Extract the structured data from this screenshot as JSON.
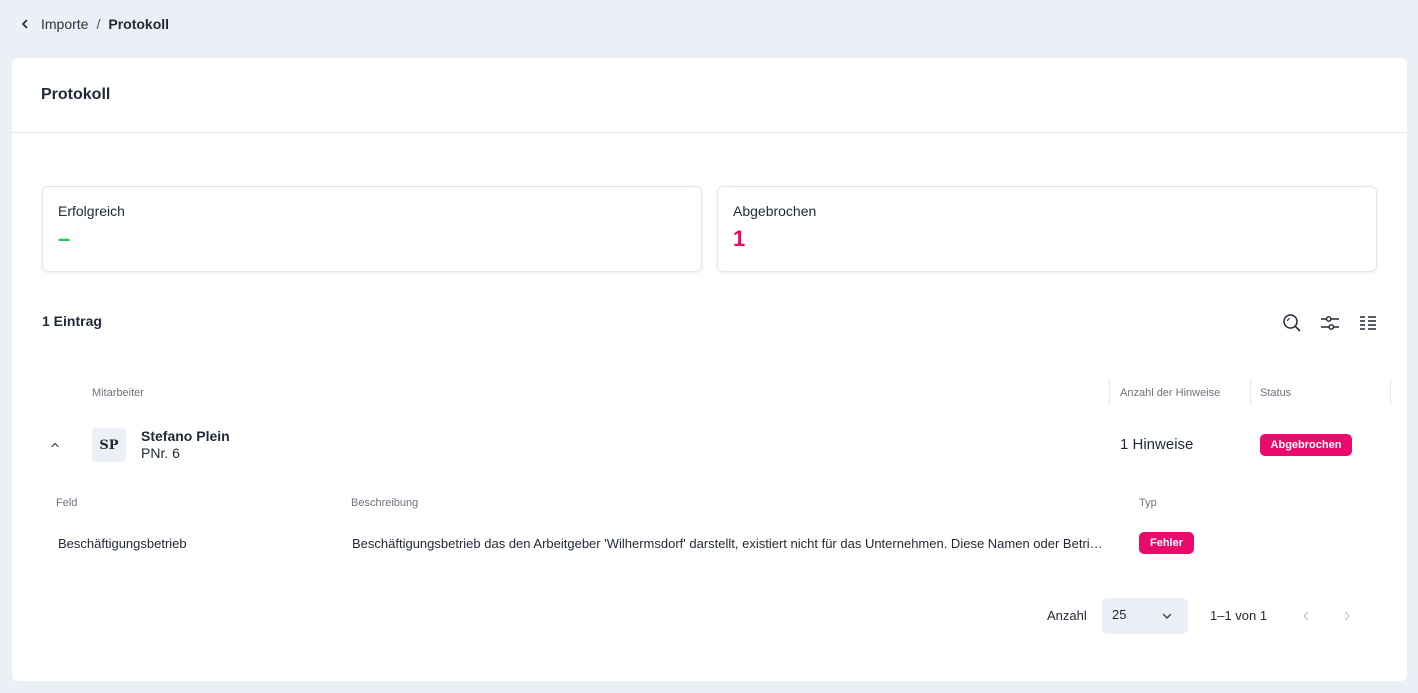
{
  "breadcrumb": {
    "parent": "Importe",
    "separator": "/",
    "current": "Protokoll"
  },
  "page": {
    "title": "Protokoll"
  },
  "stats": [
    {
      "label": "Erfolgreich",
      "value": "–",
      "color": "#22c55e"
    },
    {
      "label": "Abgebrochen",
      "value": "1",
      "color": "#ea0a6b"
    }
  ],
  "list": {
    "count_label": "1 Eintrag"
  },
  "toolbar": {
    "icons": [
      "search-icon",
      "filter-sliders-icon",
      "column-settings-icon"
    ]
  },
  "table": {
    "headers": {
      "employee": "Mitarbeiter",
      "hint_count": "Anzahl der Hinweise",
      "status": "Status"
    },
    "rows": [
      {
        "initials": "SP",
        "name": "Stefano Plein",
        "pnr": "PNr. 6",
        "hints": "1 Hinweise",
        "status": "Abgebrochen",
        "details": {
          "headers": {
            "field": "Feld",
            "description": "Beschreibung",
            "type": "Typ"
          },
          "items": [
            {
              "field": "Beschäftigungsbetrieb",
              "description": "Beschäftigungsbetrieb das den Arbeitgeber 'Wilhermsdorf' darstellt, existiert nicht für das Unternehmen. Diese Namen oder Betriebsnummern sind verfügbar.",
              "type": "Fehler"
            }
          ]
        }
      }
    ]
  },
  "pagination": {
    "label": "Anzahl",
    "page_size": "25",
    "range": "1–1 von 1"
  },
  "colors": {
    "accent": "#ea0a6b",
    "background": "#eceff5"
  }
}
